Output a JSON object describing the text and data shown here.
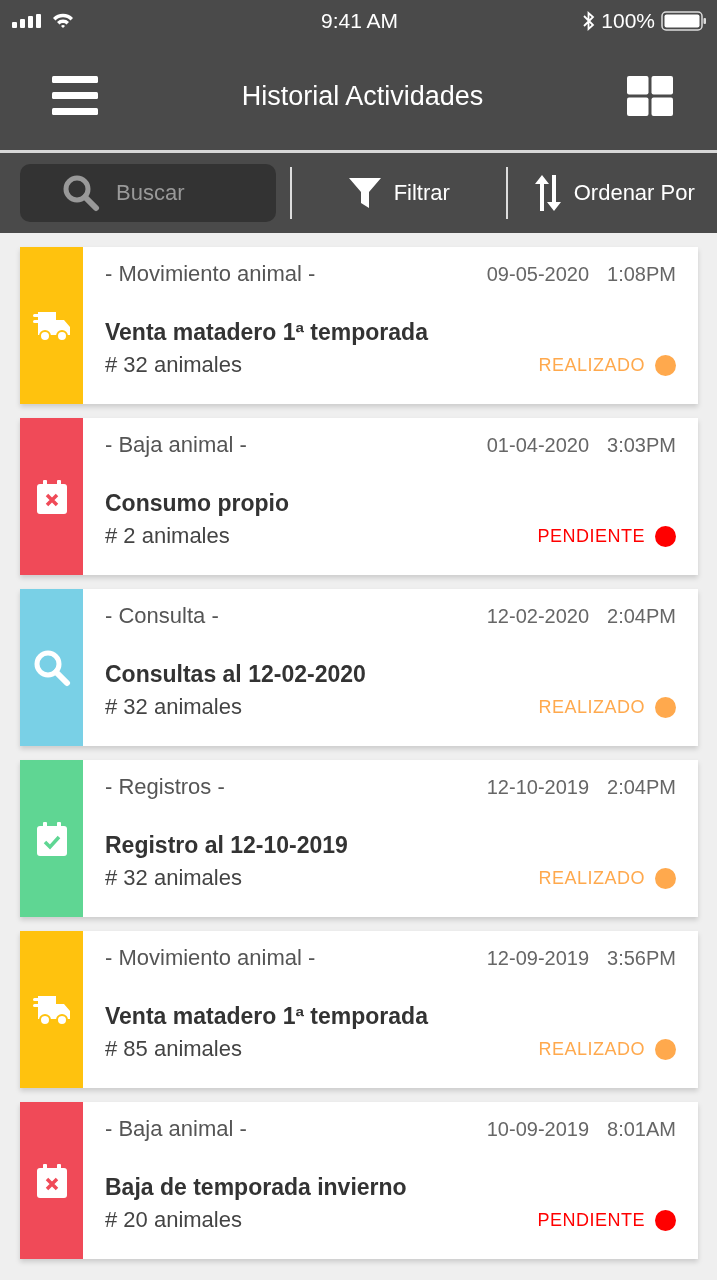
{
  "status_bar": {
    "time": "9:41 AM",
    "battery": "100%"
  },
  "header": {
    "title": "Historial Actividades"
  },
  "toolbar": {
    "search": {
      "placeholder": "Buscar"
    },
    "filter": "Filtrar",
    "sort": "Ordenar Por"
  },
  "activities": [
    {
      "kind": "movimiento",
      "color": "#ffc20e",
      "category": "- Movimiento animal -",
      "date": "09-05-2020",
      "time": "1:08PM",
      "title": "Venta matadero 1ª temporada",
      "count": "# 32 animales",
      "status": {
        "label": "REALIZADO",
        "color": "#ffa94d"
      }
    },
    {
      "kind": "baja",
      "color": "#f04a58",
      "category": "- Baja animal -",
      "date": "01-04-2020",
      "time": "3:03PM",
      "title": "Consumo propio",
      "count": "# 2 animales",
      "status": {
        "label": "PENDIENTE",
        "color": "#ff0000"
      }
    },
    {
      "kind": "consulta",
      "color": "#79d0e6",
      "category": "- Consulta -",
      "date": "12-02-2020",
      "time": "2:04PM",
      "title": "Consultas al 12-02-2020",
      "count": "# 32 animales",
      "status": {
        "label": "REALIZADO",
        "color": "#ffa94d"
      }
    },
    {
      "kind": "registro",
      "color": "#5fd693",
      "category": "- Registros -",
      "date": "12-10-2019",
      "time": "2:04PM",
      "title": "Registro al 12-10-2019",
      "count": "# 32 animales",
      "status": {
        "label": "REALIZADO",
        "color": "#ffa94d"
      }
    },
    {
      "kind": "movimiento",
      "color": "#ffc20e",
      "category": "- Movimiento animal -",
      "date": "12-09-2019",
      "time": "3:56PM",
      "title": "Venta matadero 1ª temporada",
      "count": "# 85 animales",
      "status": {
        "label": "REALIZADO",
        "color": "#ffa94d"
      }
    },
    {
      "kind": "baja",
      "color": "#f04a58",
      "category": "- Baja animal -",
      "date": "10-09-2019",
      "time": "8:01AM",
      "title": "Baja de temporada invierno",
      "count": "# 20 animales",
      "status": {
        "label": "PENDIENTE",
        "color": "#ff0000"
      }
    }
  ]
}
